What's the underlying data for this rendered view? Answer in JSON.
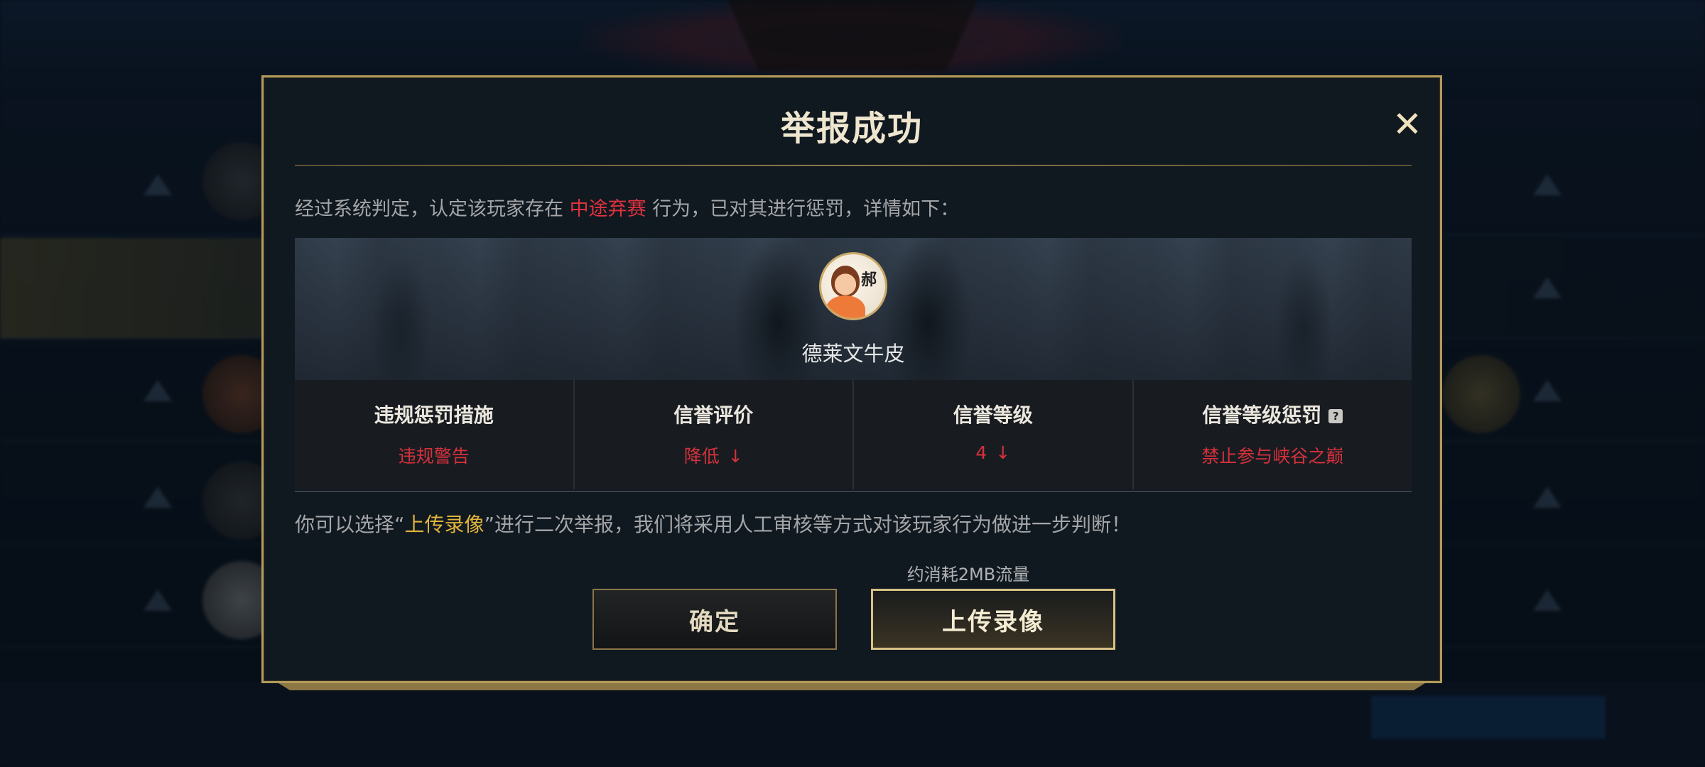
{
  "modal": {
    "title": "举报成功",
    "close_icon": "close-icon",
    "verdict": {
      "prefix": "经过系统判定，认定该玩家存在",
      "violation": "中途弃赛",
      "suffix": "行为，已对其进行惩罚，详情如下："
    },
    "player": {
      "name": "德莱文牛皮",
      "avatar_glyph": "郝"
    },
    "penalty": {
      "columns": [
        {
          "header": "违规惩罚措施",
          "value": "违规警告",
          "arrow": ""
        },
        {
          "header": "信誉评价",
          "value": "降低",
          "arrow": "↓"
        },
        {
          "header": "信誉等级",
          "value": "4",
          "arrow": "↓"
        },
        {
          "header": "信誉等级惩罚",
          "value": "禁止参与峡谷之巅",
          "arrow": "",
          "help_icon": "?"
        }
      ]
    },
    "note": {
      "prefix": "你可以选择“",
      "highlight": "上传录像",
      "suffix": "”进行二次举报，我们将采用人工审核等方式对该玩家行为做进一步判断！"
    },
    "traffic_note": "约消耗2MB流量",
    "buttons": {
      "confirm": "确定",
      "upload": "上传录像"
    }
  },
  "colors": {
    "accent_gold": "#b39a5c",
    "violation_red": "#e0323e",
    "highlight_gold": "#e1b53b",
    "panel_bg": "#101820"
  }
}
